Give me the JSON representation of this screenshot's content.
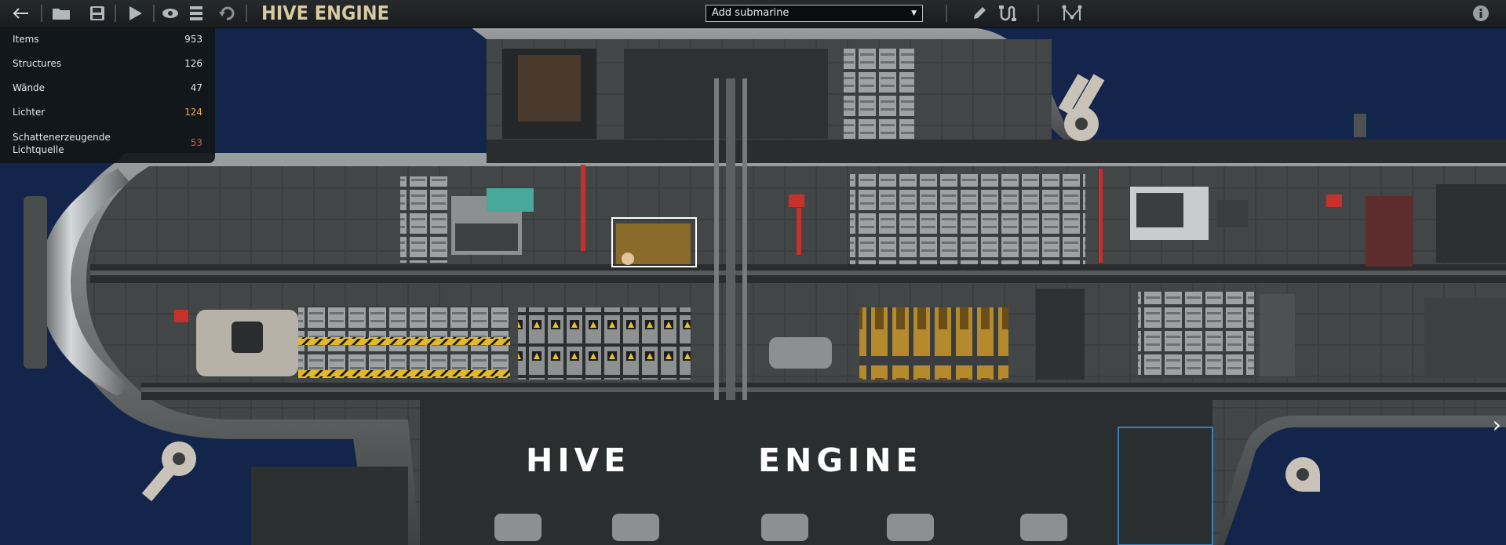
{
  "app": {
    "title": "HIVE ENGINE"
  },
  "toolbar": {
    "back": "back-arrow-icon",
    "open": "folder-icon",
    "save": "save-icon",
    "test": "play-icon",
    "visibility": "eye-icon",
    "layers": "layers-icon",
    "undo": "undo-icon",
    "pencil": "pencil-icon",
    "wiring": "wire-icon",
    "waypoints": "waypoint-icon",
    "info": "info-icon"
  },
  "submarine_select": {
    "value": "Add submarine"
  },
  "stats": {
    "rows": [
      {
        "label": "Items",
        "value": "953",
        "color": "#e6e6e6"
      },
      {
        "label": "Structures",
        "value": "126",
        "color": "#e6e6e6"
      },
      {
        "label": "Wände",
        "value": "47",
        "color": "#e6e6e6"
      },
      {
        "label": "Lichter",
        "value": "124",
        "color": "#f0a64a"
      },
      {
        "label": "Schattenerzeugende Lichtquelle",
        "value": "53",
        "color": "#e2553f"
      }
    ]
  },
  "hull_labels": {
    "left": "HIVE",
    "right": "ENGINE"
  },
  "colors": {
    "water": "#13254a",
    "hull": "#5b5f60",
    "accent_red": "#c9302c",
    "brass": "#b88a2a"
  }
}
